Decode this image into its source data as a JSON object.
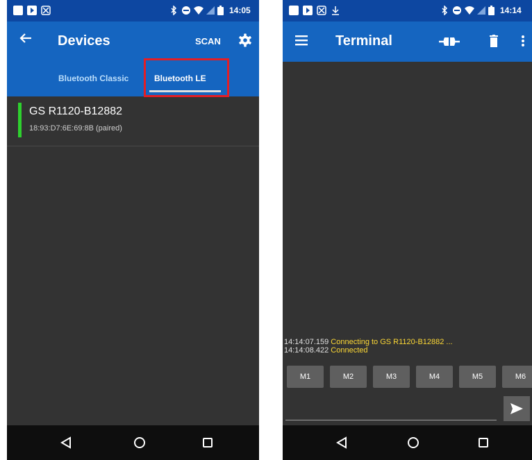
{
  "left": {
    "status": {
      "time": "14:05"
    },
    "toolbar": {
      "title": "Devices",
      "scan": "SCAN"
    },
    "tabs": {
      "classic": "Bluetooth Classic",
      "le": "Bluetooth LE"
    },
    "devices": [
      {
        "name": "GS R1120-B12882",
        "address": "18:93:D7:6E:69:8B (paired)"
      }
    ]
  },
  "right": {
    "status": {
      "time": "14:14"
    },
    "toolbar": {
      "title": "Terminal"
    },
    "log": [
      {
        "time": "14:14:07.159",
        "text": "Connecting to GS R1120-B12882 ..."
      },
      {
        "time": "14:14:08.422",
        "text": "Connected"
      }
    ],
    "macros": [
      "M1",
      "M2",
      "M3",
      "M4",
      "M5",
      "M6"
    ]
  },
  "colors": {
    "statusbar": "#0d47a1",
    "toolbar": "#1565c0",
    "background": "#333333",
    "highlight": "#e41e25",
    "connected_indicator": "#2ed12e",
    "log_text": "#fdd835"
  }
}
